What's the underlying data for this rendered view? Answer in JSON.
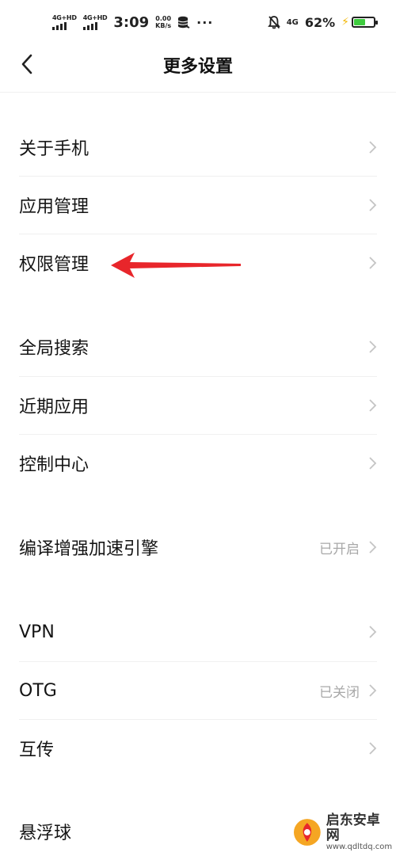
{
  "status_bar": {
    "network_1": "4G+HD",
    "network_2": "4G+HD",
    "time": "3:09",
    "speed_value": "0.00",
    "speed_unit": "KB/s",
    "more": "···",
    "network_3": "4G",
    "battery_percent": "62%",
    "battery_level": 0.62,
    "battery_color": "#3ecb3e"
  },
  "header": {
    "title": "更多设置",
    "back_icon": "chevron-left-icon"
  },
  "items": [
    {
      "label": "关于手机",
      "value": ""
    },
    {
      "label": "应用管理",
      "value": ""
    },
    {
      "label": "权限管理",
      "value": ""
    },
    {
      "label": "全局搜索",
      "value": ""
    },
    {
      "label": "近期应用",
      "value": ""
    },
    {
      "label": "控制中心",
      "value": ""
    },
    {
      "label": "编译增强加速引擎",
      "value": "已开启"
    },
    {
      "label": "VPN",
      "value": ""
    },
    {
      "label": "OTG",
      "value": "已关闭"
    },
    {
      "label": "互传",
      "value": ""
    },
    {
      "label": "悬浮球",
      "value": ""
    }
  ],
  "annotation": {
    "arrow_color": "#e8262b",
    "arrow_icon": "red-arrow-annotation"
  },
  "watermark": {
    "name": "启东安卓网",
    "url": "www.qdltdq.com"
  }
}
